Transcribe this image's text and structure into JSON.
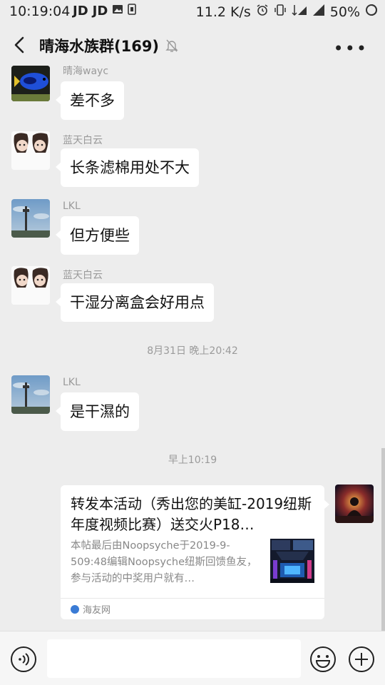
{
  "status_bar": {
    "time": "10:19:04",
    "left_icons": [
      "JD",
      "JD",
      "image-icon",
      "sim-icon"
    ],
    "net_speed": "11.2 K/s",
    "battery": "50%"
  },
  "header": {
    "title": "晴海水族群(169)",
    "back_icon": "chevron-left-icon",
    "mute_icon": "bell-mute-icon",
    "more_icon": "more-icon"
  },
  "messages": [
    {
      "sender": "晴海wayc",
      "text": "差不多"
    },
    {
      "sender": "蓝天白云",
      "text": "长条滤棉用处不大"
    },
    {
      "sender": "LKL",
      "text": "但方便些"
    },
    {
      "sender": "蓝天白云",
      "text": "干湿分离盒会好用点"
    },
    {
      "sender": "LKL",
      "text": "是干濕的"
    }
  ],
  "timestamps": [
    "8月31日 晚上20:42",
    "早上10:19"
  ],
  "link_card": {
    "title": "转发本活动（秀出您的美缸-2019纽斯年度视频比赛）送交火P18…",
    "description": "本帖最后由Noopsyche于2019-9-509:48编辑Noopsyche纽斯回馈鱼友，参与活动的中奖用户就有…",
    "source": "海友网"
  },
  "input_bar": {
    "placeholder": "",
    "voice_icon": "voice-icon",
    "emoji_icon": "emoji-icon",
    "plus_icon": "plus-icon"
  },
  "colors": {
    "background": "#ededed",
    "bubble": "#ffffff",
    "meta_text": "#9a9a9a"
  }
}
